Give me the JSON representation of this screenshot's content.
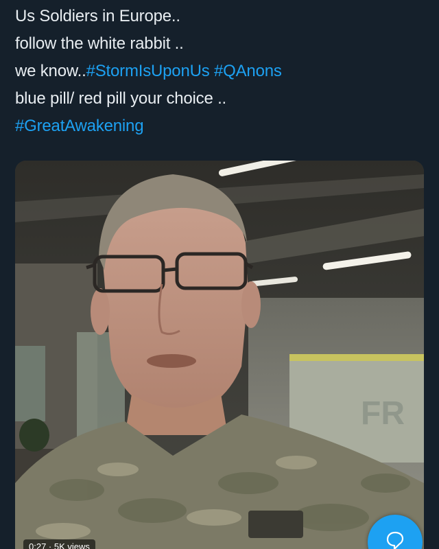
{
  "tweet": {
    "lines": [
      {
        "text": "Us Soldiers in Europe..",
        "tags": []
      },
      {
        "text": "follow the white rabbit ..",
        "tags": []
      },
      {
        "text": "we know..",
        "tags": [
          "#StormIsUponUs",
          "#QAnons"
        ]
      },
      {
        "text": "blue pill/ red pill your choice ..",
        "tags": []
      },
      {
        "text": "",
        "tags": [
          "#GreatAwakening"
        ]
      }
    ]
  },
  "media": {
    "type": "video",
    "wall_sign_text": "FR",
    "badge_text": "0:27 · 5K views"
  },
  "fab": {
    "icon": "compose-reply-icon",
    "color": "#1da1f2"
  },
  "colors": {
    "background": "#15202b",
    "text": "#e8edf1",
    "link": "#1da1f2"
  }
}
